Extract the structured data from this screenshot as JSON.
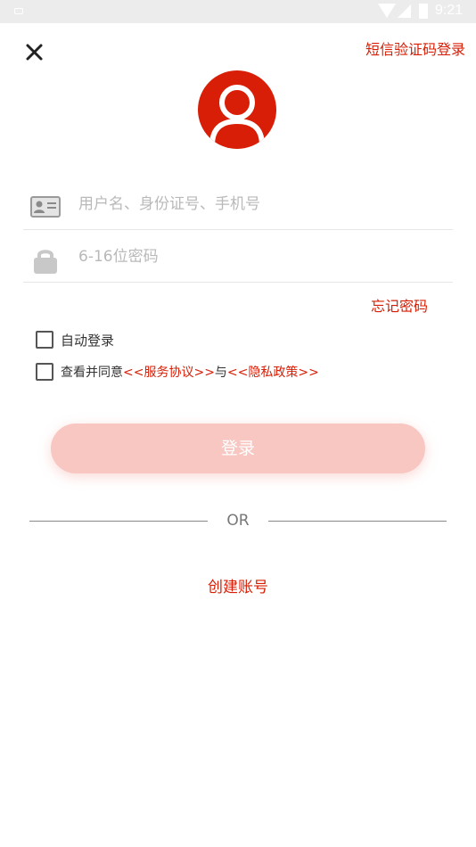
{
  "status_bar": {
    "time": "9:21",
    "icons": [
      "notification-icon",
      "wifi-icon",
      "signal-icon",
      "battery-icon"
    ]
  },
  "header": {
    "close_icon": "close-icon",
    "sms_login_label": "短信验证码登录"
  },
  "avatar": {
    "icon": "user-avatar-icon",
    "color": "#d81e06"
  },
  "form": {
    "username": {
      "icon": "id-card-icon",
      "placeholder": "用户名、身份证号、手机号",
      "value": ""
    },
    "password": {
      "icon": "lock-icon",
      "placeholder": "6-16位密码",
      "value": ""
    },
    "forgot_label": "忘记密码",
    "auto_login_label": "自动登录",
    "agree": {
      "prefix": "查看并同意",
      "service_link": "<<服务协议>>",
      "conjunction": "与",
      "privacy_link": "<<隐私政策>>"
    },
    "login_label": "登录"
  },
  "divider": {
    "text": "OR"
  },
  "create_account_label": "创建账号",
  "colors": {
    "accent": "#d81e06",
    "button_bg": "#f8c7c2",
    "placeholder": "#b9b9b9"
  }
}
